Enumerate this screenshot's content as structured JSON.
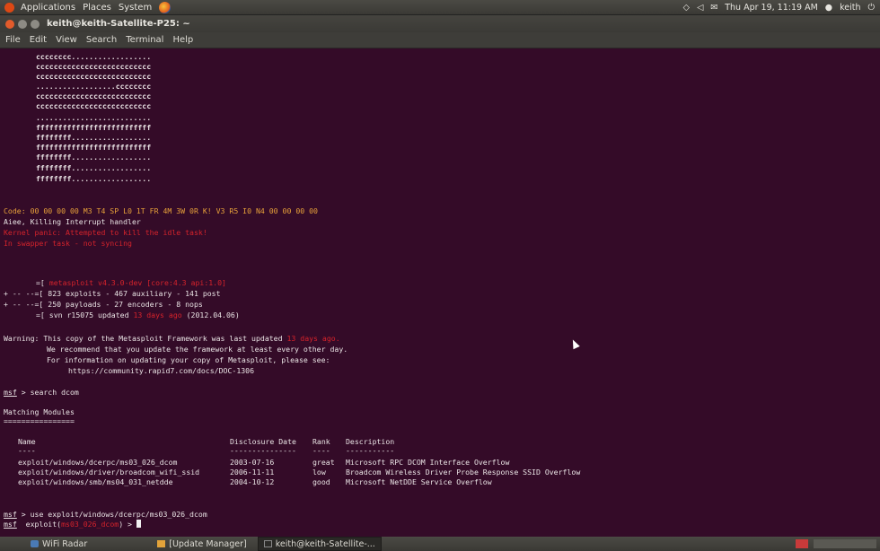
{
  "top_panel": {
    "applications": "Applications",
    "places": "Places",
    "system": "System",
    "datetime": "Thu Apr 19, 11:19 AM",
    "user": "keith"
  },
  "window": {
    "title": "keith@keith-Satellite-P25: ~"
  },
  "menubar": [
    "File",
    "Edit",
    "View",
    "Search",
    "Terminal",
    "Help"
  ],
  "terminal": {
    "ascii_art": [
      "cccccccc..................",
      "cccccccccccccccccccccccccc",
      "cccccccccccccccccccccccccc",
      "..................cccccccc",
      "cccccccccccccccccccccccccc",
      "cccccccccccccccccccccccccc",
      "..........................",
      "ffffffffffffffffffffffffff",
      "ffffffff..................",
      "ffffffffffffffffffffffffff",
      "ffffffff..................",
      "ffffffff..................",
      "ffffffff.................."
    ],
    "code_line": "Code: 00 00 00 00 M3 T4 SP L0 1T FR 4M 3W 0R K! V3 R5 I0 N4 00 00 00 00",
    "aiee_line": "Aiee, Killing Interrupt handler",
    "panic_line1": "Kernel panic: Attempted to kill the idle task!",
    "panic_line2": "In swapper task - not syncing",
    "banner": {
      "l1_prefix": "=[ ",
      "l1_red": "metasploit v4.3.0-dev [core:4.3 api:1.0]",
      "l1_suffix": "",
      "l2": "+ -- --=[ 823 exploits - 467 auxiliary - 141 post",
      "l3": "+ -- --=[ 250 payloads - 27 encoders - 8 nops",
      "l4_prefix": "=[ svn r15075 updated ",
      "l4_red": "13 days ago",
      "l4_suffix": " (2012.04.06)"
    },
    "warning": {
      "l1_prefix": "Warning: This copy of the Metasploit Framework was last updated ",
      "l1_red": "13 days ago.",
      "l2": "We recommend that you update the framework at least every other day.",
      "l3": "For information on updating your copy of Metasploit, please see:",
      "l4": "https://community.rapid7.com/docs/DOC-1306"
    },
    "search_prompt": "msf",
    "search_cmd": " > search dcom",
    "matching_title": "Matching Modules",
    "matching_underline": "================",
    "table": {
      "headers": {
        "name": "Name",
        "date": "Disclosure Date",
        "rank": "Rank",
        "desc": "Description"
      },
      "dashes": {
        "name": "----",
        "date": "---------------",
        "rank": "----",
        "desc": "-----------"
      },
      "rows": [
        {
          "name": "exploit/windows/dcerpc/ms03_026_dcom",
          "date": "2003-07-16",
          "rank": "great",
          "desc": "Microsoft RPC DCOM Interface Overflow"
        },
        {
          "name": "exploit/windows/driver/broadcom_wifi_ssid",
          "date": "2006-11-11",
          "rank": "low",
          "desc": "Broadcom Wireless Driver Probe Response SSID Overflow"
        },
        {
          "name": "exploit/windows/smb/ms04_031_netdde",
          "date": "2004-10-12",
          "rank": "good",
          "desc": "Microsoft NetDDE Service Overflow"
        }
      ]
    },
    "use_prompt": "msf",
    "use_cmd": " > use exploit/windows/dcerpc/ms03_026_dcom",
    "final_prompt": "msf",
    "final_exploit_prefix": "  exploit(",
    "final_exploit_red": "ms03_026_dcom",
    "final_exploit_suffix": ") > "
  },
  "taskbar": {
    "items": [
      {
        "label": "WiFi Radar"
      },
      {
        "label": "[Update Manager]"
      },
      {
        "label": "keith@keith-Satellite-..."
      }
    ]
  },
  "colors": {
    "terminal_bg": "#340b28",
    "error_red": "#d6232b",
    "code_orange": "#e8a23a"
  }
}
